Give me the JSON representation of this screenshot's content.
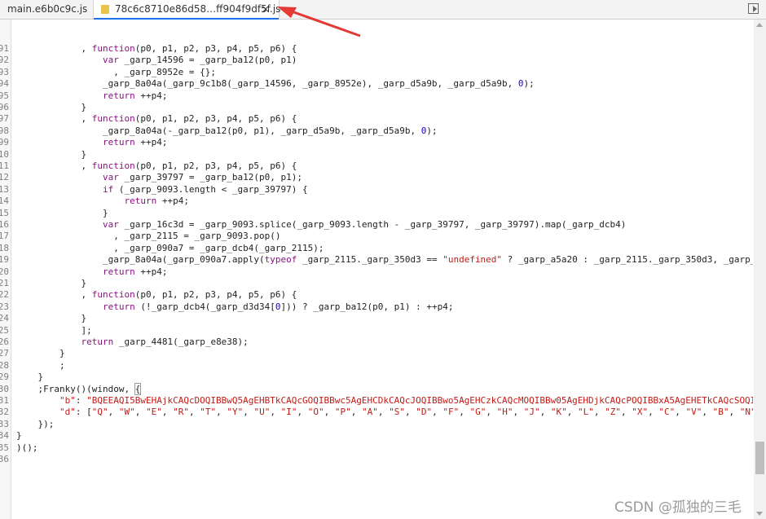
{
  "tabs": [
    {
      "label": "main.e6b0c9c.js"
    },
    {
      "label": "78c6c8710e86d58…ff904f9df5f.js",
      "close": "×"
    }
  ],
  "line_numbers": [
    "91",
    "92",
    "93",
    "94",
    "95",
    "96",
    "97",
    "98",
    "99",
    "10",
    "11",
    "12",
    "13",
    "14",
    "15",
    "16",
    "17",
    "18",
    "19",
    "20",
    "21",
    "22",
    "23",
    "24",
    "25",
    "26",
    "27",
    "28",
    "29",
    "30",
    "31",
    "32",
    "33",
    "34",
    "35",
    "36"
  ],
  "code_lines": [
    [
      {
        "t": "            , "
      },
      {
        "t": "function",
        "c": "kw"
      },
      {
        "t": "(p0, p1, p2, p3, p4, p5, p6) {"
      }
    ],
    [
      {
        "t": "                "
      },
      {
        "t": "var",
        "c": "kw"
      },
      {
        "t": " _garp_14596 = _garp_ba12(p0, p1)"
      }
    ],
    [
      {
        "t": "                  , _garp_8952e = {};"
      }
    ],
    [
      {
        "t": "                _garp_8a04a(_garp_9c1b8(_garp_14596, _garp_8952e), _garp_d5a9b, _garp_d5a9b, "
      },
      {
        "t": "0",
        "c": "num"
      },
      {
        "t": ");"
      }
    ],
    [
      {
        "t": "                "
      },
      {
        "t": "return",
        "c": "kw"
      },
      {
        "t": " ++p4;"
      }
    ],
    [
      {
        "t": "            }"
      }
    ],
    [
      {
        "t": "            , "
      },
      {
        "t": "function",
        "c": "kw"
      },
      {
        "t": "(p0, p1, p2, p3, p4, p5, p6) {"
      }
    ],
    [
      {
        "t": "                _garp_8a04a(-_garp_ba12(p0, p1), _garp_d5a9b, _garp_d5a9b, "
      },
      {
        "t": "0",
        "c": "num"
      },
      {
        "t": ");"
      }
    ],
    [
      {
        "t": "                "
      },
      {
        "t": "return",
        "c": "kw"
      },
      {
        "t": " ++p4;"
      }
    ],
    [
      {
        "t": "            }"
      }
    ],
    [
      {
        "t": "            , "
      },
      {
        "t": "function",
        "c": "kw"
      },
      {
        "t": "(p0, p1, p2, p3, p4, p5, p6) {"
      }
    ],
    [
      {
        "t": "                "
      },
      {
        "t": "var",
        "c": "kw"
      },
      {
        "t": " _garp_39797 = _garp_ba12(p0, p1);"
      }
    ],
    [
      {
        "t": "                "
      },
      {
        "t": "if",
        "c": "kw"
      },
      {
        "t": " (_garp_9093.length < _garp_39797) {"
      }
    ],
    [
      {
        "t": "                    "
      },
      {
        "t": "return",
        "c": "kw"
      },
      {
        "t": " ++p4;"
      }
    ],
    [
      {
        "t": "                }"
      }
    ],
    [
      {
        "t": "                "
      },
      {
        "t": "var",
        "c": "kw"
      },
      {
        "t": " _garp_16c3d = _garp_9093.splice(_garp_9093.length - _garp_39797, _garp_39797).map(_garp_dcb4)"
      }
    ],
    [
      {
        "t": "                  , _garp_2115 = _garp_9093.pop()"
      }
    ],
    [
      {
        "t": "                  , _garp_090a7 = _garp_dcb4(_garp_2115);"
      }
    ],
    [
      {
        "t": "                _garp_8a04a(_garp_090a7.apply("
      },
      {
        "t": "typeof",
        "c": "kw"
      },
      {
        "t": " _garp_2115._garp_350d3 == "
      },
      {
        "t": "\"undefined\"",
        "c": "str"
      },
      {
        "t": " ? _garp_a5a20 : _garp_2115._garp_350d3, _garp_"
      }
    ],
    [
      {
        "t": "                "
      },
      {
        "t": "return",
        "c": "kw"
      },
      {
        "t": " ++p4;"
      }
    ],
    [
      {
        "t": "            }"
      }
    ],
    [
      {
        "t": "            , "
      },
      {
        "t": "function",
        "c": "kw"
      },
      {
        "t": "(p0, p1, p2, p3, p4, p5, p6) {"
      }
    ],
    [
      {
        "t": "                "
      },
      {
        "t": "return",
        "c": "kw"
      },
      {
        "t": " (!_garp_dcb4(_garp_d3d34["
      },
      {
        "t": "0",
        "c": "num"
      },
      {
        "t": "])) ? _garp_ba12(p0, p1) : ++p4;"
      }
    ],
    [
      {
        "t": "            }"
      }
    ],
    [
      {
        "t": "            ];"
      }
    ],
    [
      {
        "t": "            "
      },
      {
        "t": "return",
        "c": "kw"
      },
      {
        "t": " _garp_4481(_garp_e8e38);"
      }
    ],
    [
      {
        "t": "        }"
      }
    ],
    [
      {
        "t": "        ;"
      }
    ],
    [
      {
        "t": "    }"
      }
    ],
    [
      {
        "t": "    ;Franky()(window, "
      },
      {
        "t": "{",
        "c": "brace-hl"
      }
    ],
    [
      {
        "t": "        "
      },
      {
        "t": "\"b\"",
        "c": "str"
      },
      {
        "t": ": "
      },
      {
        "t": "\"BQEEAQI5BwEHAjkCAQcDOQIBBwQ5AgEHBTkCAQcGOQIBBwc5AgEHCDkCAQcJOQIBBwo5AgEHCzkCAQcMOQIBBw05AgEHDjkCAQcPOQIBBxA5AgEHETkCAQcSOQI",
        "c": "str"
      }
    ],
    [
      {
        "t": "        "
      },
      {
        "t": "\"d\"",
        "c": "str"
      },
      {
        "t": ": ["
      },
      {
        "t": "\"Q\"",
        "c": "str"
      },
      {
        "t": ", "
      },
      {
        "t": "\"W\"",
        "c": "str"
      },
      {
        "t": ", "
      },
      {
        "t": "\"E\"",
        "c": "str"
      },
      {
        "t": ", "
      },
      {
        "t": "\"R\"",
        "c": "str"
      },
      {
        "t": ", "
      },
      {
        "t": "\"T\"",
        "c": "str"
      },
      {
        "t": ", "
      },
      {
        "t": "\"Y\"",
        "c": "str"
      },
      {
        "t": ", "
      },
      {
        "t": "\"U\"",
        "c": "str"
      },
      {
        "t": ", "
      },
      {
        "t": "\"I\"",
        "c": "str"
      },
      {
        "t": ", "
      },
      {
        "t": "\"O\"",
        "c": "str"
      },
      {
        "t": ", "
      },
      {
        "t": "\"P\"",
        "c": "str"
      },
      {
        "t": ", "
      },
      {
        "t": "\"A\"",
        "c": "str"
      },
      {
        "t": ", "
      },
      {
        "t": "\"S\"",
        "c": "str"
      },
      {
        "t": ", "
      },
      {
        "t": "\"D\"",
        "c": "str"
      },
      {
        "t": ", "
      },
      {
        "t": "\"F\"",
        "c": "str"
      },
      {
        "t": ", "
      },
      {
        "t": "\"G\"",
        "c": "str"
      },
      {
        "t": ", "
      },
      {
        "t": "\"H\"",
        "c": "str"
      },
      {
        "t": ", "
      },
      {
        "t": "\"J\"",
        "c": "str"
      },
      {
        "t": ", "
      },
      {
        "t": "\"K\"",
        "c": "str"
      },
      {
        "t": ", "
      },
      {
        "t": "\"L\"",
        "c": "str"
      },
      {
        "t": ", "
      },
      {
        "t": "\"Z\"",
        "c": "str"
      },
      {
        "t": ", "
      },
      {
        "t": "\"X\"",
        "c": "str"
      },
      {
        "t": ", "
      },
      {
        "t": "\"C\"",
        "c": "str"
      },
      {
        "t": ", "
      },
      {
        "t": "\"V\"",
        "c": "str"
      },
      {
        "t": ", "
      },
      {
        "t": "\"B\"",
        "c": "str"
      },
      {
        "t": ", "
      },
      {
        "t": "\"N\"",
        "c": "str"
      }
    ],
    [
      {
        "t": "    });"
      }
    ],
    [
      {
        "t": "}"
      }
    ],
    [
      {
        "t": ")();"
      }
    ],
    [
      {
        "t": ""
      }
    ]
  ],
  "watermark": "CSDN @孤独的三毛",
  "colors": {
    "keyword": "#881280",
    "string": "#c41a16",
    "number": "#1c00cf",
    "annotation_arrow": "#e53935",
    "active_tab_underline": "#1a73e8"
  }
}
